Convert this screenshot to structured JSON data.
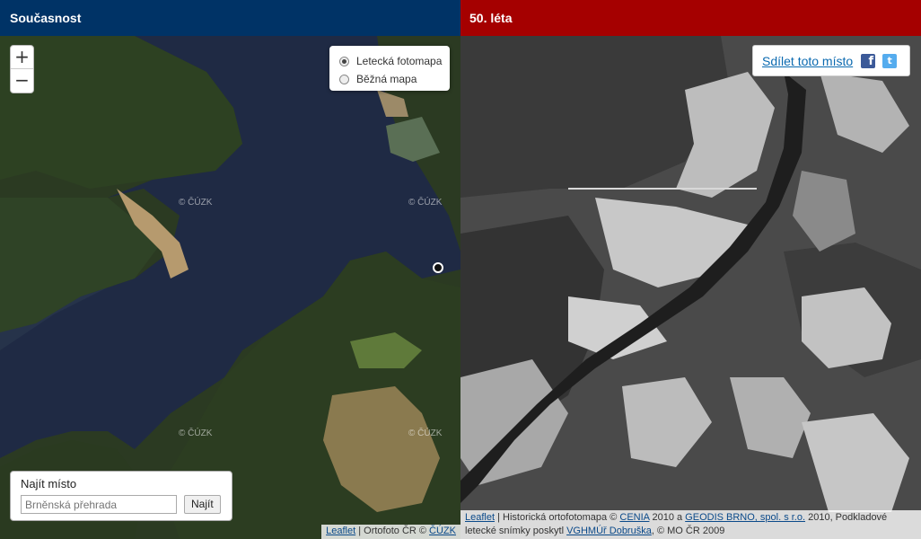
{
  "left_pane": {
    "header": "Současnost",
    "zoom_in": "+",
    "zoom_out": "−",
    "layers": [
      {
        "label": "Letecká fotomapa",
        "selected": true
      },
      {
        "label": "Běžná mapa",
        "selected": false
      }
    ],
    "watermarks": [
      "© ČÚZK",
      "© ČÚZK",
      "© ČÚZK",
      "© ČÚZK"
    ],
    "search": {
      "label": "Najít místo",
      "placeholder": "Brněnská přehrada",
      "button": "Najít"
    },
    "attribution": {
      "leaflet": "Leaflet",
      "text": " | Ortofoto ČR © ",
      "cuzk": "ČÚZK"
    }
  },
  "right_pane": {
    "header": "50. léta",
    "share": {
      "label": "Sdílet toto místo",
      "facebook_icon": "f",
      "twitter_icon": "t"
    },
    "attribution": {
      "leaflet": "Leaflet",
      "part1": " | Historická ortofotomapa © ",
      "cenia": "CENIA",
      "part2": " 2010 a ",
      "geodis": "GEODIS BRNO, spol. s r.o.",
      "part3": " 2010, Podkladové letecké snímky poskytl ",
      "vghmuf": "VGHMÚř Dobruška",
      "part4": ", © MO ČR 2009"
    }
  },
  "colors": {
    "left_header": "#003366",
    "right_header": "#a50000",
    "water_present": "#1f2a44",
    "forest_present": "#2a3a1e"
  }
}
